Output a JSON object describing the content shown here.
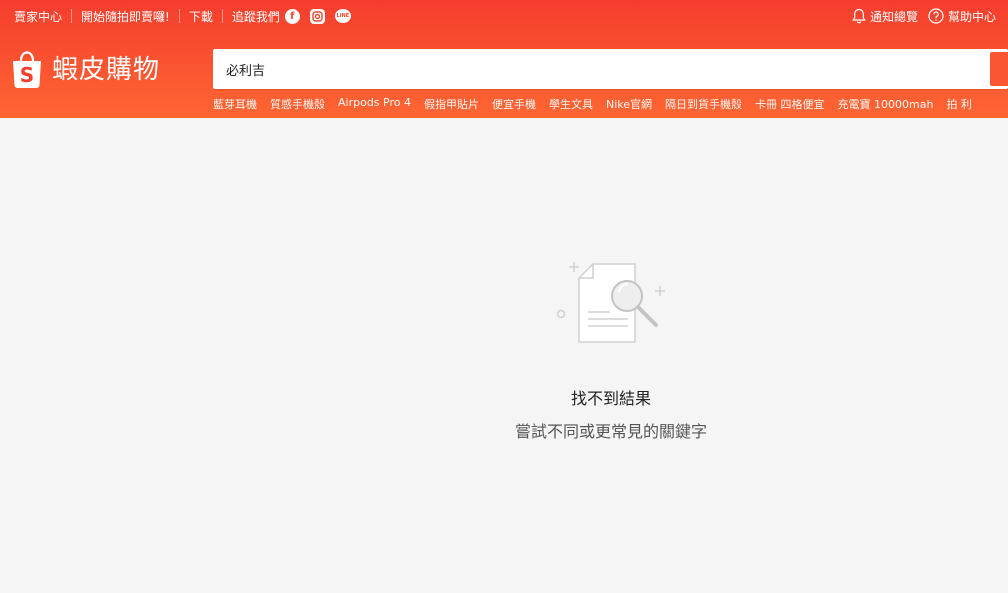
{
  "topbar": {
    "seller_center": "賣家中心",
    "start_selling": "開始隨拍即賣囉!",
    "download": "下載",
    "follow_us": "追蹤我們",
    "notifications": "通知總覽",
    "help": "幫助中心"
  },
  "brand": {
    "name": "蝦皮購物",
    "logo_letter": "S"
  },
  "search": {
    "value": "必利吉"
  },
  "suggestions": [
    "藍芽耳機",
    "質感手機殼",
    "Airpods Pro 4",
    "假指甲貼片",
    "便宜手機",
    "學生文具",
    "Nike官網",
    "隔日到貨手機殼",
    "卡冊 四格便宜",
    "充電寶 10000mah",
    "拍 利"
  ],
  "empty": {
    "title": "找不到結果",
    "subtitle": "嘗試不同或更常見的關鍵字"
  },
  "colors": {
    "header_top": "#f53d2d",
    "header_bottom": "#ff6633",
    "background": "#f5f5f5",
    "search_button": "#fb5533"
  }
}
